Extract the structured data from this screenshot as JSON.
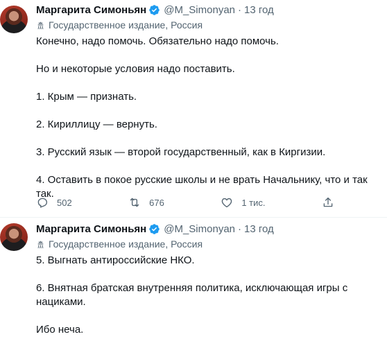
{
  "tweets": [
    {
      "author_name": "Маргарита Симоньян",
      "handle": "@M_Simonyan",
      "separator": "·",
      "time": "13 год",
      "label": "Государственное издание, Россия",
      "paragraphs": [
        "Конечно, надо помочь. Обязательно надо помочь.",
        "Но и некоторые условия надо поставить.",
        "1. Крым — признать.",
        "2. Кириллицу — вернуть.",
        "3. Русский язык — второй государственный, как в Киргизии.",
        "4. Оставить в покое русские школы и не врать Начальнику, что и так так."
      ],
      "actions": {
        "reply_count": "502",
        "retweet_count": "676",
        "like_count": "1 тис."
      }
    },
    {
      "author_name": "Маргарита Симоньян",
      "handle": "@M_Simonyan",
      "separator": "·",
      "time": "13 год",
      "label": "Государственное издание, Россия",
      "paragraphs": [
        "5. Выгнать антироссийские НКО.",
        "6. Внятная братская внутренняя политика, исключающая игры с нациками.",
        "Ибо неча."
      ]
    }
  ],
  "colors": {
    "text_primary": "#0f1419",
    "text_secondary": "#536471",
    "verified_blue": "#1d9bf0",
    "divider": "#eff3f4"
  }
}
